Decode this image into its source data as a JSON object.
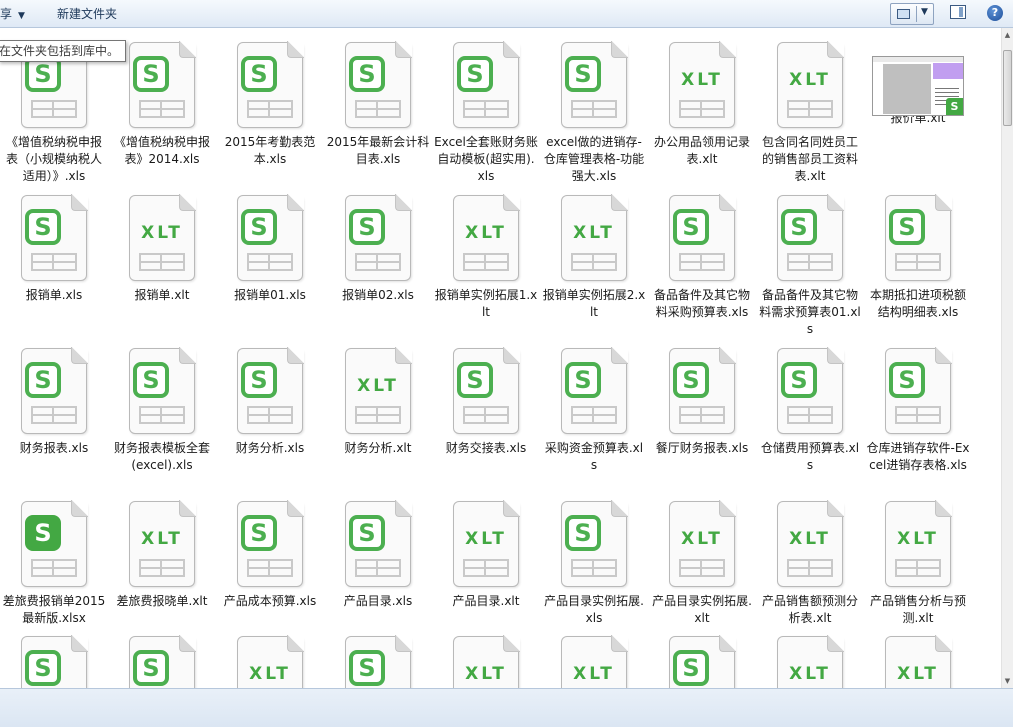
{
  "toolbar": {
    "share_label": "享",
    "new_folder_label": "新建文件夹"
  },
  "tooltip": "在文件夹包括到库中。",
  "files": [
    {
      "name": "《增值税纳税申报表（小规模纳税人适用）》.xls",
      "icon": "s-badge"
    },
    {
      "name": "《增值税纳税申报表》2014.xls",
      "icon": "s-badge"
    },
    {
      "name": "2015年考勤表范本.xls",
      "icon": "s-badge"
    },
    {
      "name": "2015年最新会计科目表.xls",
      "icon": "s-badge"
    },
    {
      "name": "Excel全套账财务账自动模板(超实用).xls",
      "icon": "s-badge"
    },
    {
      "name": "excel做的进销存-仓库管理表格-功能强大.xls",
      "icon": "s-badge"
    },
    {
      "name": "办公用品领用记录表.xlt",
      "icon": "xlt"
    },
    {
      "name": "包含同名同姓员工的销售部员工资料表.xlt",
      "icon": "xlt"
    },
    {
      "name": "报价单.xlt",
      "icon": "thumbnail"
    },
    {
      "name": "报销单.xls",
      "icon": "s-badge"
    },
    {
      "name": "报销单.xlt",
      "icon": "xlt"
    },
    {
      "name": "报销单01.xls",
      "icon": "s-badge"
    },
    {
      "name": "报销单02.xls",
      "icon": "s-badge"
    },
    {
      "name": "报销单实例拓展1.xlt",
      "icon": "xlt"
    },
    {
      "name": "报销单实例拓展2.xlt",
      "icon": "xlt"
    },
    {
      "name": "备品备件及其它物料采购预算表.xls",
      "icon": "s-badge"
    },
    {
      "name": "备品备件及其它物料需求预算表01.xls",
      "icon": "s-badge"
    },
    {
      "name": "本期抵扣进项税额结构明细表.xls",
      "icon": "s-badge"
    },
    {
      "name": "财务报表.xls",
      "icon": "s-badge"
    },
    {
      "name": "财务报表模板全套(excel).xls",
      "icon": "s-badge"
    },
    {
      "name": "财务分析.xls",
      "icon": "s-badge"
    },
    {
      "name": "财务分析.xlt",
      "icon": "xlt"
    },
    {
      "name": "财务交接表.xls",
      "icon": "s-badge"
    },
    {
      "name": "采购资金预算表.xls",
      "icon": "s-badge"
    },
    {
      "name": "餐厅财务报表.xls",
      "icon": "s-badge"
    },
    {
      "name": "仓储费用预算表.xls",
      "icon": "s-badge"
    },
    {
      "name": "仓库进销存软件-Excel进销存表格.xls",
      "icon": "s-badge"
    },
    {
      "name": "差旅费报销单2015最新版.xlsx",
      "icon": "s-filled"
    },
    {
      "name": "差旅费报晓单.xlt",
      "icon": "xlt"
    },
    {
      "name": "产品成本预算.xls",
      "icon": "s-badge"
    },
    {
      "name": "产品目录.xls",
      "icon": "s-badge"
    },
    {
      "name": "产品目录.xlt",
      "icon": "xlt"
    },
    {
      "name": "产品目录实例拓展.xls",
      "icon": "s-badge"
    },
    {
      "name": "产品目录实例拓展.xlt",
      "icon": "xlt"
    },
    {
      "name": "产品销售额预测分析表.xlt",
      "icon": "xlt"
    },
    {
      "name": "产品销售分析与预测.xlt",
      "icon": "xlt"
    },
    {
      "name": "",
      "icon": "s-badge"
    },
    {
      "name": "",
      "icon": "s-badge"
    },
    {
      "name": "",
      "icon": "xlt"
    },
    {
      "name": "",
      "icon": "s-badge"
    },
    {
      "name": "",
      "icon": "xlt"
    },
    {
      "name": "",
      "icon": "xlt"
    },
    {
      "name": "",
      "icon": "s-badge"
    },
    {
      "name": "",
      "icon": "xlt"
    },
    {
      "name": "",
      "icon": "xlt"
    }
  ],
  "glyphs": {
    "s": "S",
    "xlt": "XLT",
    "help": "?"
  }
}
